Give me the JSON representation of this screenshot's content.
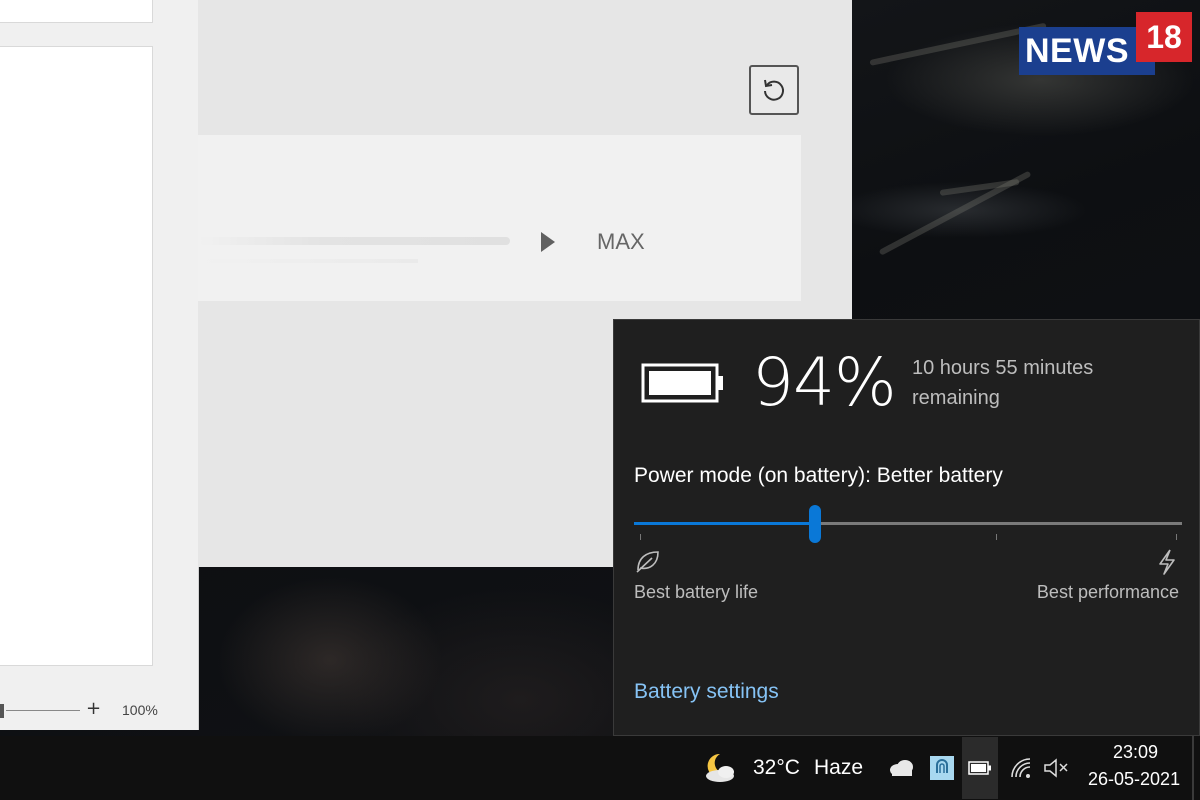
{
  "watermark": {
    "word": "NEWS",
    "number": "18"
  },
  "document_window": {
    "zoom_percent": "100%",
    "zoom_plus": "+"
  },
  "settings_window": {
    "slider_end_label": "MAX"
  },
  "battery_flyout": {
    "percent": "94%",
    "remaining_line1": "10 hours 55 minutes",
    "remaining_line2": "remaining",
    "power_mode_label": "Power mode (on battery): Better battery",
    "power_slider_value": 0.33,
    "left_label": "Best battery life",
    "right_label": "Best performance",
    "settings_link": "Battery settings",
    "accent_color": "#0a78d7",
    "link_color": "#86c3f5"
  },
  "taskbar": {
    "weather_icon": "moon-cloud-icon",
    "temperature": "32°C",
    "condition": "Haze",
    "tray_icons": [
      "onedrive-cloud-icon",
      "app-tray-icon",
      "battery-icon",
      "wifi-icon",
      "speaker-muted-icon"
    ],
    "time": "23:09",
    "date": "26-05-2021"
  }
}
